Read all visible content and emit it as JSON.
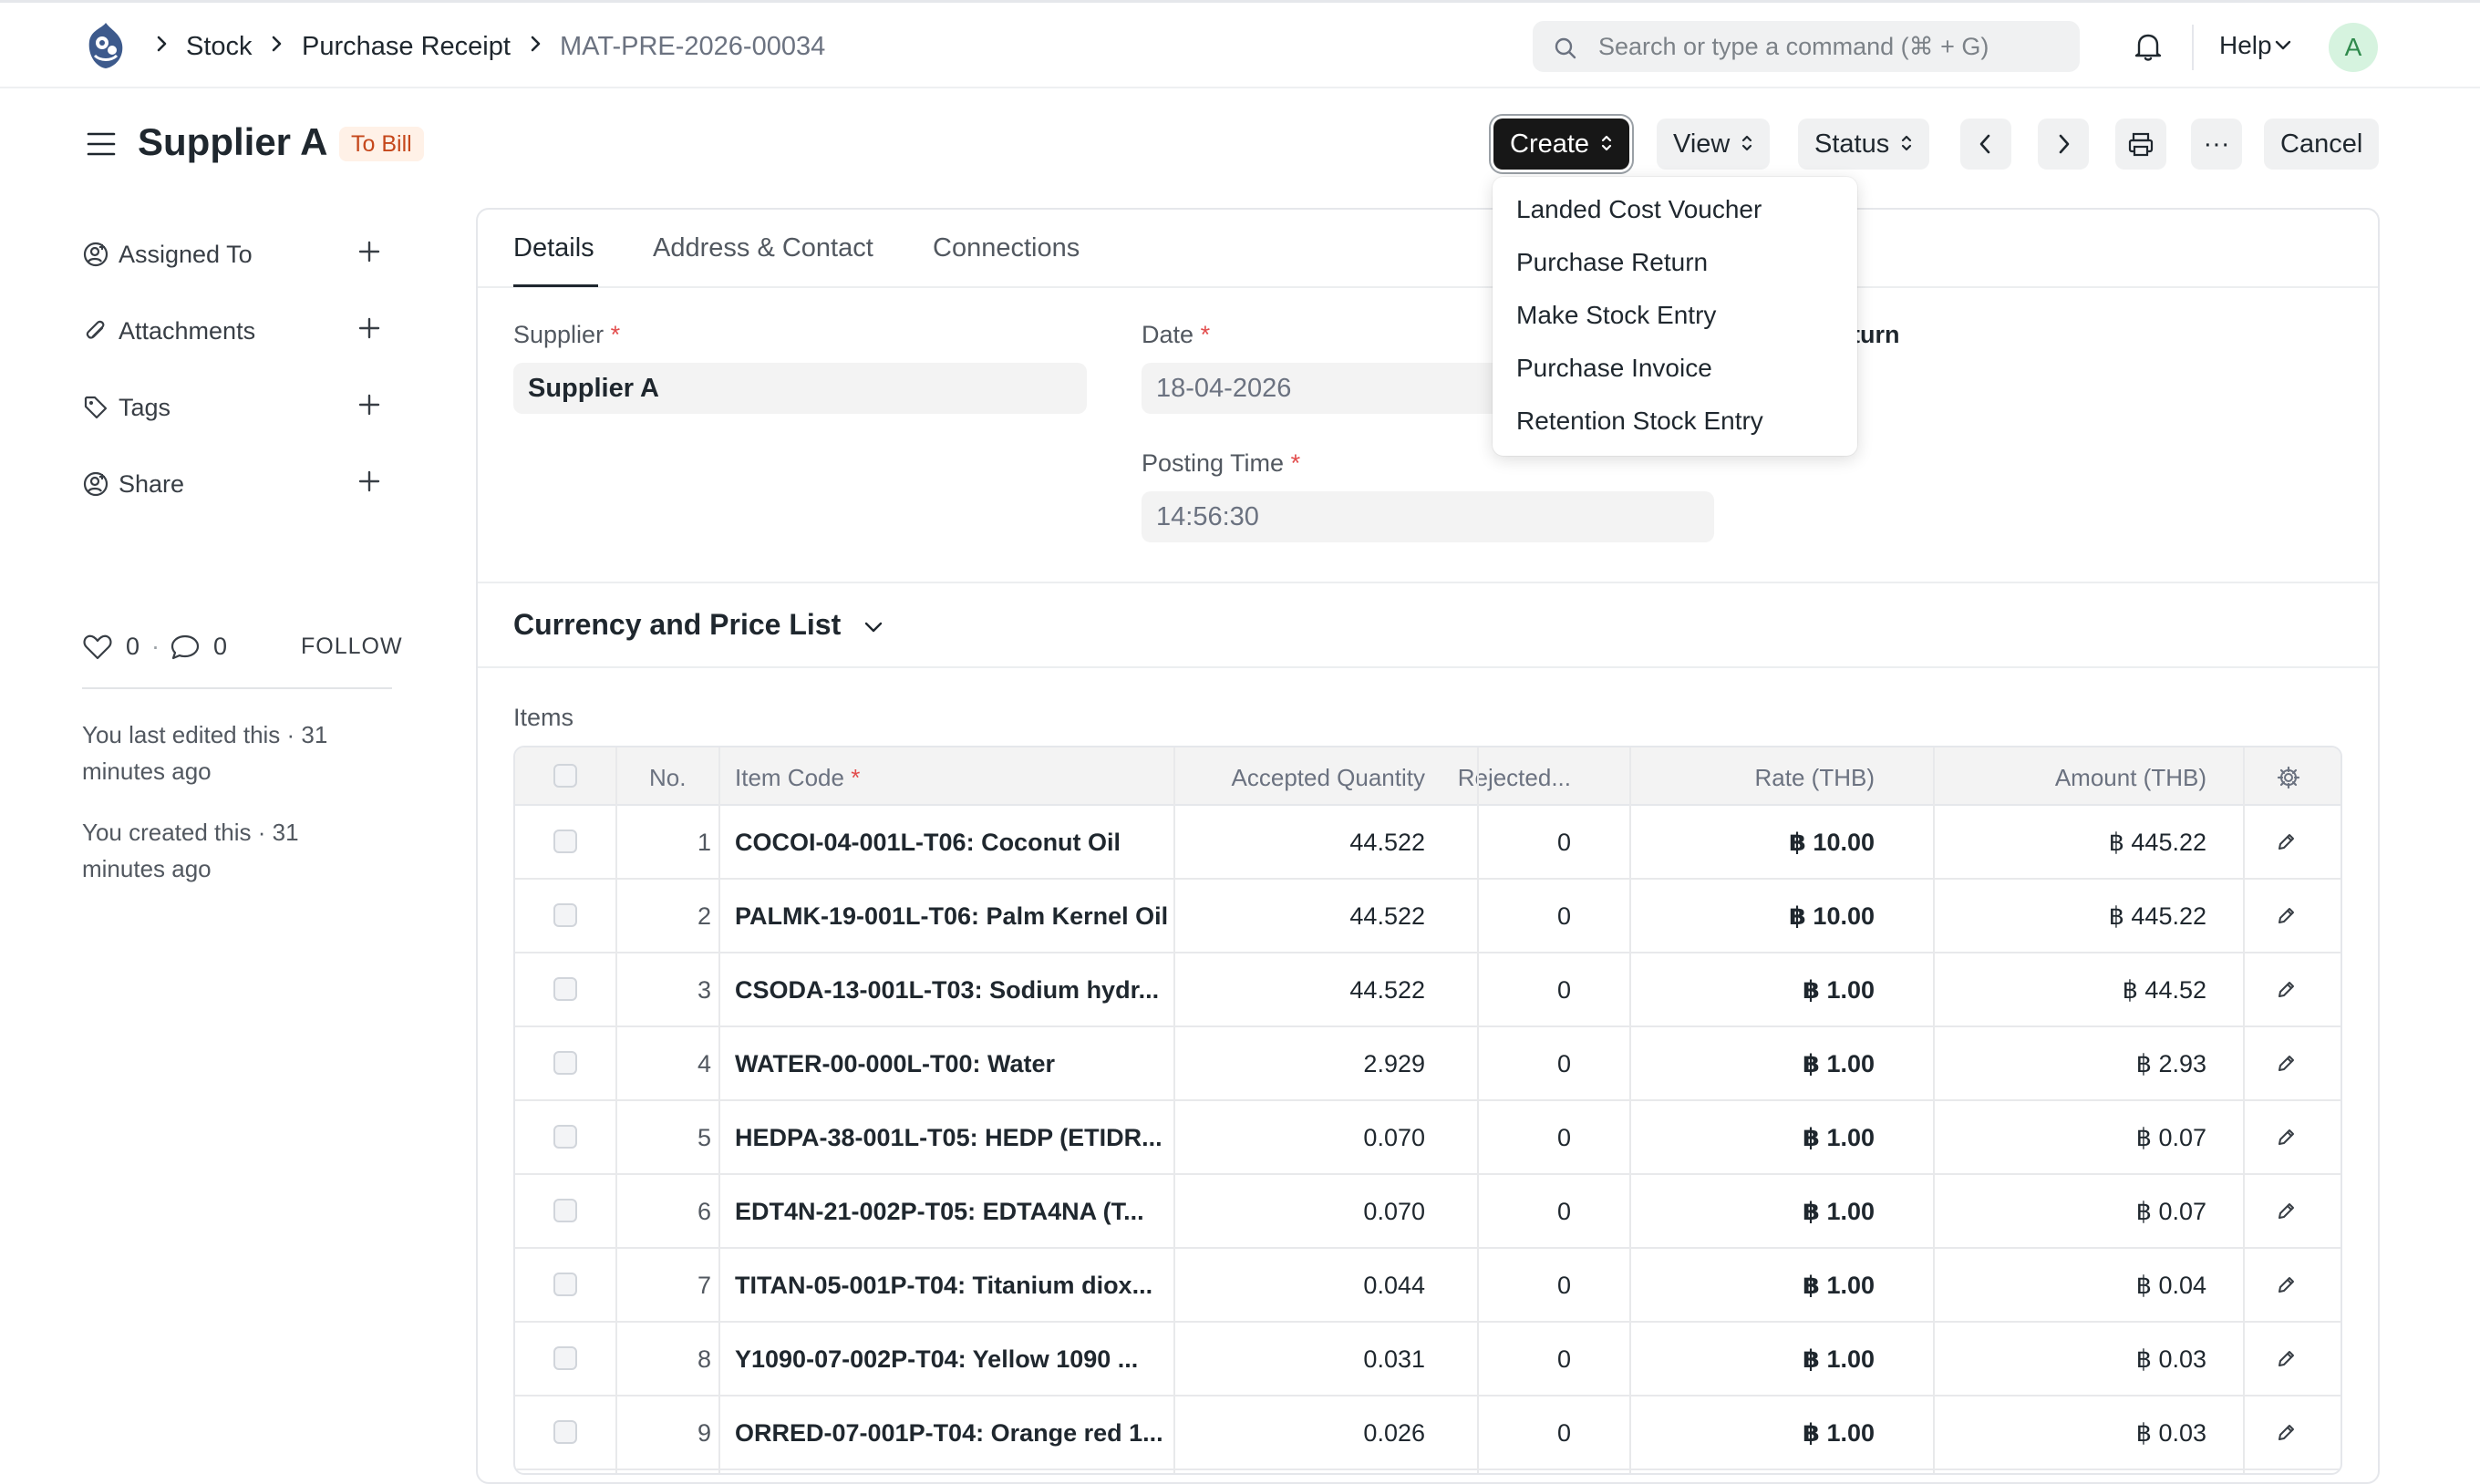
{
  "breadcrumb": [
    "Stock",
    "Purchase Receipt",
    "MAT-PRE-2026-00034"
  ],
  "search": {
    "placeholder": "Search or type a command (⌘ + G)"
  },
  "nav": {
    "help_label": "Help",
    "avatar_initial": "A"
  },
  "page": {
    "title": "Supplier A",
    "status": "To Bill",
    "status_color": "#c5471b"
  },
  "actions": {
    "create": "Create",
    "view": "View",
    "status": "Status",
    "cancel": "Cancel",
    "more": "···"
  },
  "create_menu": [
    "Landed Cost Voucher",
    "Purchase Return",
    "Make Stock Entry",
    "Purchase Invoice",
    "Retention Stock Entry"
  ],
  "sidebar": {
    "items": [
      {
        "label": "Assigned To",
        "icon": "assign-icon"
      },
      {
        "label": "Attachments",
        "icon": "paperclip-icon"
      },
      {
        "label": "Tags",
        "icon": "tag-icon"
      },
      {
        "label": "Share",
        "icon": "share-icon"
      }
    ],
    "likes": "0",
    "comments": "0",
    "follow": "FOLLOW",
    "last_edited": "You last edited this · 31 minutes ago",
    "created": "You created this · 31 minutes ago"
  },
  "tabs": [
    "Details",
    "Address & Contact",
    "Connections"
  ],
  "form": {
    "supplier_label": "Supplier",
    "supplier_value": "Supplier A",
    "date_label": "Date",
    "date_value": "18-04-2026",
    "posting_time_label": "Posting Time",
    "posting_time_value": "14:56:30",
    "peek_text": "eturn"
  },
  "section": {
    "title": "Currency and Price List"
  },
  "items": {
    "label": "Items",
    "columns": [
      "No.",
      "Item Code",
      "Accepted Quantity",
      "Rejected...",
      "Rate (THB)",
      "Amount (THB)"
    ],
    "rows": [
      {
        "no": "1",
        "code": "COCOI-04-001L-T06: Coconut Oil",
        "qty": "44.522",
        "rej": "0",
        "rate": "฿ 10.00",
        "amount": "฿ 445.22"
      },
      {
        "no": "2",
        "code": "PALMK-19-001L-T06: Palm Kernel Oil",
        "qty": "44.522",
        "rej": "0",
        "rate": "฿ 10.00",
        "amount": "฿ 445.22"
      },
      {
        "no": "3",
        "code": "CSODA-13-001L-T03: Sodium hydr...",
        "qty": "44.522",
        "rej": "0",
        "rate": "฿ 1.00",
        "amount": "฿ 44.52"
      },
      {
        "no": "4",
        "code": "WATER-00-000L-T00: Water",
        "qty": "2.929",
        "rej": "0",
        "rate": "฿ 1.00",
        "amount": "฿ 2.93"
      },
      {
        "no": "5",
        "code": "HEDPA-38-001L-T05: HEDP (ETIDR...",
        "qty": "0.070",
        "rej": "0",
        "rate": "฿ 1.00",
        "amount": "฿ 0.07"
      },
      {
        "no": "6",
        "code": "EDT4N-21-002P-T05: EDTA4NA (T...",
        "qty": "0.070",
        "rej": "0",
        "rate": "฿ 1.00",
        "amount": "฿ 0.07"
      },
      {
        "no": "7",
        "code": "TITAN-05-001P-T04: Titanium diox...",
        "qty": "0.044",
        "rej": "0",
        "rate": "฿ 1.00",
        "amount": "฿ 0.04"
      },
      {
        "no": "8",
        "code": "Y1090-07-002P-T04: Yellow 1090 ...",
        "qty": "0.031",
        "rej": "0",
        "rate": "฿ 1.00",
        "amount": "฿ 0.03"
      },
      {
        "no": "9",
        "code": "ORRED-07-001P-T04: Orange red 1...",
        "qty": "0.026",
        "rej": "0",
        "rate": "฿ 1.00",
        "amount": "฿ 0.03"
      }
    ]
  }
}
